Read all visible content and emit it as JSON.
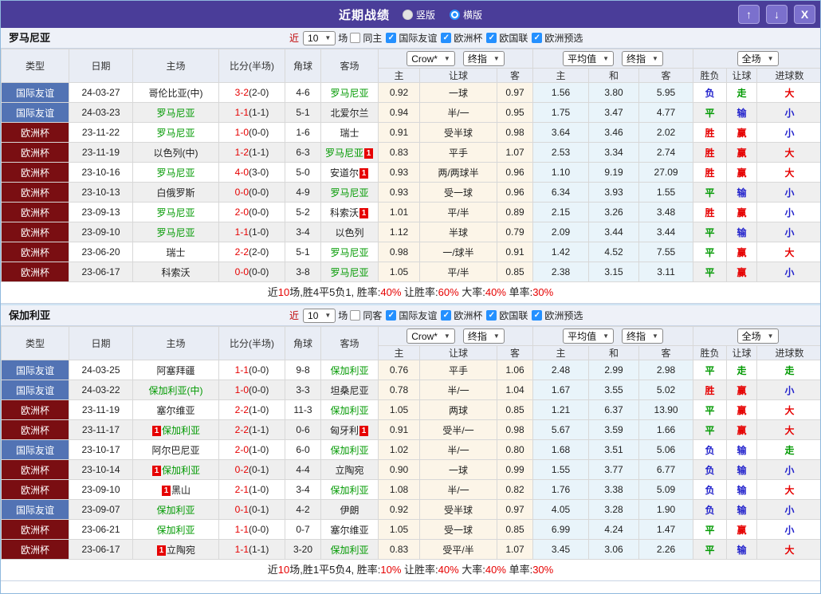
{
  "colors": {
    "accent_purple": "#4a3d99",
    "league_friendly_bg": "#5273b4",
    "league_cup_bg": "#7a0e12",
    "team_highlight_green": "#009900",
    "win_red": "#e60000",
    "draw_green": "#009900",
    "lose_blue": "#2222cc",
    "checkbox_blue": "#2490ff"
  },
  "titlebar": {
    "title": "近期战绩",
    "radio_vertical": "竖版",
    "radio_horizontal": "横版",
    "selected_mode": "横版",
    "icons": {
      "up": "↑",
      "down": "↓",
      "close": "X"
    }
  },
  "table_header": {
    "type": "类型",
    "date": "日期",
    "home": "主场",
    "score": "比分(半场)",
    "corner": "角球",
    "away": "客场",
    "odds_provider": "Crow*",
    "odds_final": "终指",
    "avg_provider": "平均值",
    "avg_final": "终指",
    "scope": "全场",
    "o_home": "主",
    "o_handicap": "让球",
    "o_away": "客",
    "a_home": "主",
    "a_draw": "和",
    "a_away": "客",
    "r_wdl": "胜负",
    "r_handicap": "让球",
    "r_goals": "进球数"
  },
  "sections": [
    {
      "team": "罗马尼亚",
      "filter": {
        "near": "近",
        "count": "10",
        "unit": "场",
        "same_label": "同主",
        "same_checked": false,
        "leagues": [
          "国际友谊",
          "欧洲杯",
          "欧国联",
          "欧洲预选"
        ]
      },
      "rows": [
        {
          "type": "国际友谊",
          "tc": "blue",
          "date": "24-03-27",
          "home": "哥伦比亚(中)",
          "hg": false,
          "hc": false,
          "score": "3-2",
          "half": "(2-0)",
          "corner": "4-6",
          "away": "罗马尼亚",
          "ag": true,
          "ac": false,
          "o": [
            "0.92",
            "一球",
            "0.97"
          ],
          "a": [
            "1.56",
            "3.80",
            "5.95"
          ],
          "r": [
            [
              "负",
              "b"
            ],
            [
              "走",
              "g"
            ],
            [
              "大",
              "r"
            ]
          ]
        },
        {
          "type": "国际友谊",
          "tc": "blue",
          "date": "24-03-23",
          "home": "罗马尼亚",
          "hg": true,
          "hc": false,
          "score": "1-1",
          "half": "(1-1)",
          "corner": "5-1",
          "away": "北爱尔兰",
          "ag": false,
          "ac": false,
          "o": [
            "0.94",
            "半/一",
            "0.95"
          ],
          "a": [
            "1.75",
            "3.47",
            "4.77"
          ],
          "r": [
            [
              "平",
              "g"
            ],
            [
              "输",
              "b"
            ],
            [
              "小",
              "b"
            ]
          ]
        },
        {
          "type": "欧洲杯",
          "tc": "maroon",
          "date": "23-11-22",
          "home": "罗马尼亚",
          "hg": true,
          "hc": false,
          "score": "1-0",
          "half": "(0-0)",
          "corner": "1-6",
          "away": "瑞士",
          "ag": false,
          "ac": false,
          "o": [
            "0.91",
            "受半球",
            "0.98"
          ],
          "a": [
            "3.64",
            "3.46",
            "2.02"
          ],
          "r": [
            [
              "胜",
              "r"
            ],
            [
              "赢",
              "r"
            ],
            [
              "小",
              "b"
            ]
          ]
        },
        {
          "type": "欧洲杯",
          "tc": "maroon",
          "date": "23-11-19",
          "home": "以色列(中)",
          "hg": false,
          "hc": false,
          "score": "1-2",
          "half": "(1-1)",
          "corner": "6-3",
          "away": "罗马尼亚",
          "ag": true,
          "ac": true,
          "o": [
            "0.83",
            "平手",
            "1.07"
          ],
          "a": [
            "2.53",
            "3.34",
            "2.74"
          ],
          "r": [
            [
              "胜",
              "r"
            ],
            [
              "赢",
              "r"
            ],
            [
              "大",
              "r"
            ]
          ]
        },
        {
          "type": "欧洲杯",
          "tc": "maroon",
          "date": "23-10-16",
          "home": "罗马尼亚",
          "hg": true,
          "hc": false,
          "score": "4-0",
          "half": "(3-0)",
          "corner": "5-0",
          "away": "安道尔",
          "ag": false,
          "ac": true,
          "o": [
            "0.93",
            "两/两球半",
            "0.96"
          ],
          "a": [
            "1.10",
            "9.19",
            "27.09"
          ],
          "r": [
            [
              "胜",
              "r"
            ],
            [
              "赢",
              "r"
            ],
            [
              "大",
              "r"
            ]
          ]
        },
        {
          "type": "欧洲杯",
          "tc": "maroon",
          "date": "23-10-13",
          "home": "白俄罗斯",
          "hg": false,
          "hc": false,
          "score": "0-0",
          "half": "(0-0)",
          "corner": "4-9",
          "away": "罗马尼亚",
          "ag": true,
          "ac": false,
          "o": [
            "0.93",
            "受一球",
            "0.96"
          ],
          "a": [
            "6.34",
            "3.93",
            "1.55"
          ],
          "r": [
            [
              "平",
              "g"
            ],
            [
              "输",
              "b"
            ],
            [
              "小",
              "b"
            ]
          ]
        },
        {
          "type": "欧洲杯",
          "tc": "maroon",
          "date": "23-09-13",
          "home": "罗马尼亚",
          "hg": true,
          "hc": false,
          "score": "2-0",
          "half": "(0-0)",
          "corner": "5-2",
          "away": "科索沃",
          "ag": false,
          "ac": true,
          "o": [
            "1.01",
            "平/半",
            "0.89"
          ],
          "a": [
            "2.15",
            "3.26",
            "3.48"
          ],
          "r": [
            [
              "胜",
              "r"
            ],
            [
              "赢",
              "r"
            ],
            [
              "小",
              "b"
            ]
          ]
        },
        {
          "type": "欧洲杯",
          "tc": "maroon",
          "date": "23-09-10",
          "home": "罗马尼亚",
          "hg": true,
          "hc": false,
          "score": "1-1",
          "half": "(1-0)",
          "corner": "3-4",
          "away": "以色列",
          "ag": false,
          "ac": false,
          "o": [
            "1.12",
            "半球",
            "0.79"
          ],
          "a": [
            "2.09",
            "3.44",
            "3.44"
          ],
          "r": [
            [
              "平",
              "g"
            ],
            [
              "输",
              "b"
            ],
            [
              "小",
              "b"
            ]
          ]
        },
        {
          "type": "欧洲杯",
          "tc": "maroon",
          "date": "23-06-20",
          "home": "瑞士",
          "hg": false,
          "hc": false,
          "score": "2-2",
          "half": "(2-0)",
          "corner": "5-1",
          "away": "罗马尼亚",
          "ag": true,
          "ac": false,
          "o": [
            "0.98",
            "一/球半",
            "0.91"
          ],
          "a": [
            "1.42",
            "4.52",
            "7.55"
          ],
          "r": [
            [
              "平",
              "g"
            ],
            [
              "赢",
              "r"
            ],
            [
              "大",
              "r"
            ]
          ]
        },
        {
          "type": "欧洲杯",
          "tc": "maroon",
          "date": "23-06-17",
          "home": "科索沃",
          "hg": false,
          "hc": false,
          "score": "0-0",
          "half": "(0-0)",
          "corner": "3-8",
          "away": "罗马尼亚",
          "ag": true,
          "ac": false,
          "o": [
            "1.05",
            "平/半",
            "0.85"
          ],
          "a": [
            "2.38",
            "3.15",
            "3.11"
          ],
          "r": [
            [
              "平",
              "g"
            ],
            [
              "赢",
              "r"
            ],
            [
              "小",
              "b"
            ]
          ]
        }
      ],
      "summary": [
        {
          "t": "近",
          "c": "k"
        },
        {
          "t": "10",
          "c": "r"
        },
        {
          "t": "场,胜4平5负1, 胜率:",
          "c": "k"
        },
        {
          "t": "40%",
          "c": "r"
        },
        {
          "t": " 让胜率:",
          "c": "k"
        },
        {
          "t": "60%",
          "c": "r"
        },
        {
          "t": " 大率:",
          "c": "k"
        },
        {
          "t": "40%",
          "c": "r"
        },
        {
          "t": " 单率:",
          "c": "k"
        },
        {
          "t": "30%",
          "c": "r"
        }
      ]
    },
    {
      "team": "保加利亚",
      "filter": {
        "near": "近",
        "count": "10",
        "unit": "场",
        "same_label": "同客",
        "same_checked": false,
        "leagues": [
          "国际友谊",
          "欧洲杯",
          "欧国联",
          "欧洲预选"
        ]
      },
      "rows": [
        {
          "type": "国际友谊",
          "tc": "blue",
          "date": "24-03-25",
          "home": "阿塞拜疆",
          "hg": false,
          "hc": false,
          "score": "1-1",
          "half": "(0-0)",
          "corner": "9-8",
          "away": "保加利亚",
          "ag": true,
          "ac": false,
          "o": [
            "0.76",
            "平手",
            "1.06"
          ],
          "a": [
            "2.48",
            "2.99",
            "2.98"
          ],
          "r": [
            [
              "平",
              "g"
            ],
            [
              "走",
              "g"
            ],
            [
              "走",
              "g"
            ]
          ]
        },
        {
          "type": "国际友谊",
          "tc": "blue",
          "date": "24-03-22",
          "home": "保加利亚(中)",
          "hg": true,
          "hc": false,
          "score": "1-0",
          "half": "(0-0)",
          "corner": "3-3",
          "away": "坦桑尼亚",
          "ag": false,
          "ac": false,
          "o": [
            "0.78",
            "半/一",
            "1.04"
          ],
          "a": [
            "1.67",
            "3.55",
            "5.02"
          ],
          "r": [
            [
              "胜",
              "r"
            ],
            [
              "赢",
              "r"
            ],
            [
              "小",
              "b"
            ]
          ]
        },
        {
          "type": "欧洲杯",
          "tc": "maroon",
          "date": "23-11-19",
          "home": "塞尔维亚",
          "hg": false,
          "hc": false,
          "score": "2-2",
          "half": "(1-0)",
          "corner": "11-3",
          "away": "保加利亚",
          "ag": true,
          "ac": false,
          "o": [
            "1.05",
            "两球",
            "0.85"
          ],
          "a": [
            "1.21",
            "6.37",
            "13.90"
          ],
          "r": [
            [
              "平",
              "g"
            ],
            [
              "赢",
              "r"
            ],
            [
              "大",
              "r"
            ]
          ]
        },
        {
          "type": "欧洲杯",
          "tc": "maroon",
          "date": "23-11-17",
          "home": "保加利亚",
          "hg": true,
          "hc": true,
          "score": "2-2",
          "half": "(1-1)",
          "corner": "0-6",
          "away": "匈牙利",
          "ag": false,
          "ac": true,
          "o": [
            "0.91",
            "受半/一",
            "0.98"
          ],
          "a": [
            "5.67",
            "3.59",
            "1.66"
          ],
          "r": [
            [
              "平",
              "g"
            ],
            [
              "赢",
              "r"
            ],
            [
              "大",
              "r"
            ]
          ]
        },
        {
          "type": "国际友谊",
          "tc": "blue",
          "date": "23-10-17",
          "home": "阿尔巴尼亚",
          "hg": false,
          "hc": false,
          "score": "2-0",
          "half": "(1-0)",
          "corner": "6-0",
          "away": "保加利亚",
          "ag": true,
          "ac": false,
          "o": [
            "1.02",
            "半/一",
            "0.80"
          ],
          "a": [
            "1.68",
            "3.51",
            "5.06"
          ],
          "r": [
            [
              "负",
              "b"
            ],
            [
              "输",
              "b"
            ],
            [
              "走",
              "g"
            ]
          ]
        },
        {
          "type": "欧洲杯",
          "tc": "maroon",
          "date": "23-10-14",
          "home": "保加利亚",
          "hg": true,
          "hc": true,
          "score": "0-2",
          "half": "(0-1)",
          "corner": "4-4",
          "away": "立陶宛",
          "ag": false,
          "ac": false,
          "o": [
            "0.90",
            "一球",
            "0.99"
          ],
          "a": [
            "1.55",
            "3.77",
            "6.77"
          ],
          "r": [
            [
              "负",
              "b"
            ],
            [
              "输",
              "b"
            ],
            [
              "小",
              "b"
            ]
          ]
        },
        {
          "type": "欧洲杯",
          "tc": "maroon",
          "date": "23-09-10",
          "home": "黑山",
          "hg": false,
          "hc": true,
          "score": "2-1",
          "half": "(1-0)",
          "corner": "3-4",
          "away": "保加利亚",
          "ag": true,
          "ac": false,
          "o": [
            "1.08",
            "半/一",
            "0.82"
          ],
          "a": [
            "1.76",
            "3.38",
            "5.09"
          ],
          "r": [
            [
              "负",
              "b"
            ],
            [
              "输",
              "b"
            ],
            [
              "大",
              "r"
            ]
          ]
        },
        {
          "type": "国际友谊",
          "tc": "blue",
          "date": "23-09-07",
          "home": "保加利亚",
          "hg": true,
          "hc": false,
          "score": "0-1",
          "half": "(0-1)",
          "corner": "4-2",
          "away": "伊朗",
          "ag": false,
          "ac": false,
          "o": [
            "0.92",
            "受半球",
            "0.97"
          ],
          "a": [
            "4.05",
            "3.28",
            "1.90"
          ],
          "r": [
            [
              "负",
              "b"
            ],
            [
              "输",
              "b"
            ],
            [
              "小",
              "b"
            ]
          ]
        },
        {
          "type": "欧洲杯",
          "tc": "maroon",
          "date": "23-06-21",
          "home": "保加利亚",
          "hg": true,
          "hc": false,
          "score": "1-1",
          "half": "(0-0)",
          "corner": "0-7",
          "away": "塞尔维亚",
          "ag": false,
          "ac": false,
          "o": [
            "1.05",
            "受一球",
            "0.85"
          ],
          "a": [
            "6.99",
            "4.24",
            "1.47"
          ],
          "r": [
            [
              "平",
              "g"
            ],
            [
              "赢",
              "r"
            ],
            [
              "小",
              "b"
            ]
          ]
        },
        {
          "type": "欧洲杯",
          "tc": "maroon",
          "date": "23-06-17",
          "home": "立陶宛",
          "hg": false,
          "hc": true,
          "score": "1-1",
          "half": "(1-1)",
          "corner": "3-20",
          "away": "保加利亚",
          "ag": true,
          "ac": false,
          "o": [
            "0.83",
            "受平/半",
            "1.07"
          ],
          "a": [
            "3.45",
            "3.06",
            "2.26"
          ],
          "r": [
            [
              "平",
              "g"
            ],
            [
              "输",
              "b"
            ],
            [
              "大",
              "r"
            ]
          ]
        }
      ],
      "summary": [
        {
          "t": "近",
          "c": "k"
        },
        {
          "t": "10",
          "c": "r"
        },
        {
          "t": "场,胜1平5负4, 胜率:",
          "c": "k"
        },
        {
          "t": "10%",
          "c": "r"
        },
        {
          "t": " 让胜率:",
          "c": "k"
        },
        {
          "t": "40%",
          "c": "r"
        },
        {
          "t": " 大率:",
          "c": "k"
        },
        {
          "t": "40%",
          "c": "r"
        },
        {
          "t": " 单率:",
          "c": "k"
        },
        {
          "t": "30%",
          "c": "r"
        }
      ]
    }
  ]
}
